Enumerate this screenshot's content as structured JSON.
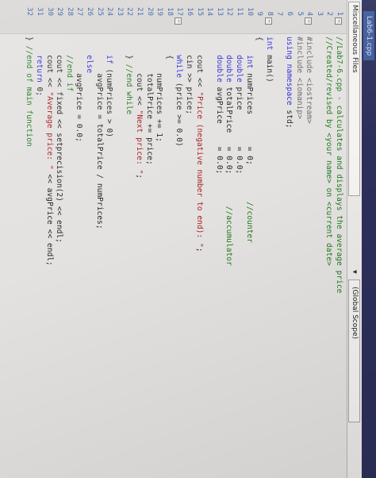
{
  "tab": {
    "title": "Lab6-1.cpp"
  },
  "nav": {
    "left": "Miscellaneous Files",
    "right": "(Global Scope)"
  },
  "lines": [
    {
      "n": "1",
      "t": "//Lab7-6.cpp - calculates and displays the average price"
    },
    {
      "n": "2",
      "t": "//Created/revised by <your name> on <current date>"
    },
    {
      "n": "3",
      "t": ""
    },
    {
      "n": "4",
      "t": "#include <iostream>"
    },
    {
      "n": "5",
      "t": "#include <iomanip>"
    },
    {
      "n": "6",
      "t": "using namespace std;"
    },
    {
      "n": "7",
      "t": ""
    },
    {
      "n": "8",
      "t": "int main()"
    },
    {
      "n": "9",
      "t": "{"
    },
    {
      "n": "10",
      "t": "    int numPrices       = 0;        //counter"
    },
    {
      "n": "11",
      "t": "    double price        = 0.0;"
    },
    {
      "n": "12",
      "t": "    double totalPrice   = 0.0;       //accumulator"
    },
    {
      "n": "13",
      "t": "    double avgPrice     = 0.0;"
    },
    {
      "n": "14",
      "t": ""
    },
    {
      "n": "15",
      "t": "    cout << \"Price (negative number to end): \";"
    },
    {
      "n": "16",
      "t": "    cin >> price;"
    },
    {
      "n": "17",
      "t": "    while (price >= 0.0)"
    },
    {
      "n": "18",
      "t": "    {"
    },
    {
      "n": "19",
      "t": "        numPrices += 1;"
    },
    {
      "n": "20",
      "t": "        totalPrice += price;"
    },
    {
      "n": "21",
      "t": "        cout << \"Next price: \";"
    },
    {
      "n": "22",
      "t": "    } //end while"
    },
    {
      "n": "23",
      "t": ""
    },
    {
      "n": "24",
      "t": "    if (numPrices > 0)"
    },
    {
      "n": "25",
      "t": "        avgPrice = totalPrice / numPrices;"
    },
    {
      "n": "26",
      "t": "    else"
    },
    {
      "n": "27",
      "t": "        avgPrice = 0.0;"
    },
    {
      "n": "28",
      "t": "    //end if"
    },
    {
      "n": "29",
      "t": "    cout << fixed << setprecision(2) << endl;"
    },
    {
      "n": "30",
      "t": "    cout << \"Average price: \" << avgPrice << endl;"
    },
    {
      "n": "31",
      "t": "    return 0;"
    },
    {
      "n": "32",
      "t": "} //end of main function"
    }
  ]
}
